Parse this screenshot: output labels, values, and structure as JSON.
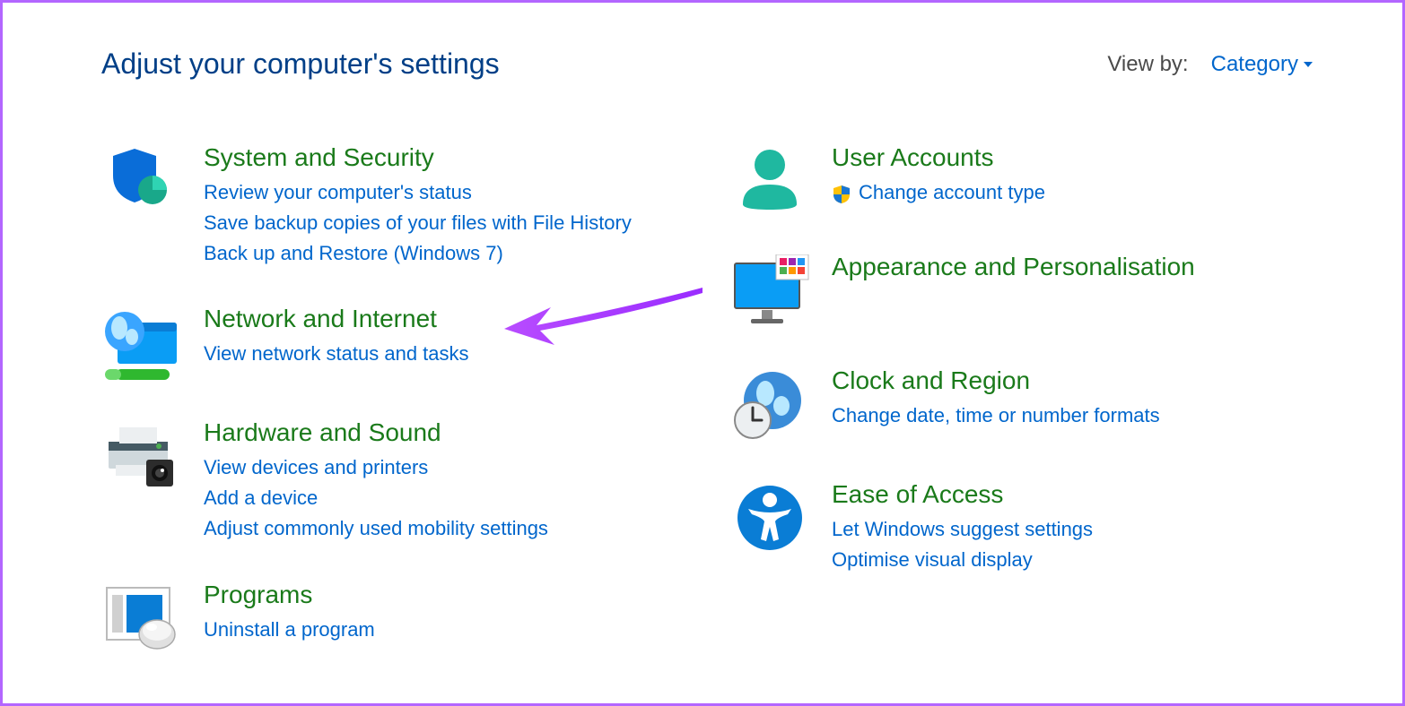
{
  "page_title": "Adjust your computer's settings",
  "view_by": {
    "label": "View by:",
    "value": "Category"
  },
  "left": [
    {
      "title": "System and Security",
      "links": [
        {
          "text": "Review your computer's status"
        },
        {
          "text": "Save backup copies of your files with File History"
        },
        {
          "text": "Back up and Restore (Windows 7)"
        }
      ]
    },
    {
      "title": "Network and Internet",
      "links": [
        {
          "text": "View network status and tasks"
        }
      ]
    },
    {
      "title": "Hardware and Sound",
      "links": [
        {
          "text": "View devices and printers"
        },
        {
          "text": "Add a device"
        },
        {
          "text": "Adjust commonly used mobility settings"
        }
      ]
    },
    {
      "title": "Programs",
      "links": [
        {
          "text": "Uninstall a program"
        }
      ]
    }
  ],
  "right": [
    {
      "title": "User Accounts",
      "links": [
        {
          "text": "Change account type",
          "shield": true
        }
      ]
    },
    {
      "title": "Appearance and Personalisation",
      "links": []
    },
    {
      "title": "Clock and Region",
      "links": [
        {
          "text": "Change date, time or number formats"
        }
      ]
    },
    {
      "title": "Ease of Access",
      "links": [
        {
          "text": "Let Windows suggest settings"
        },
        {
          "text": "Optimise visual display"
        }
      ]
    }
  ]
}
